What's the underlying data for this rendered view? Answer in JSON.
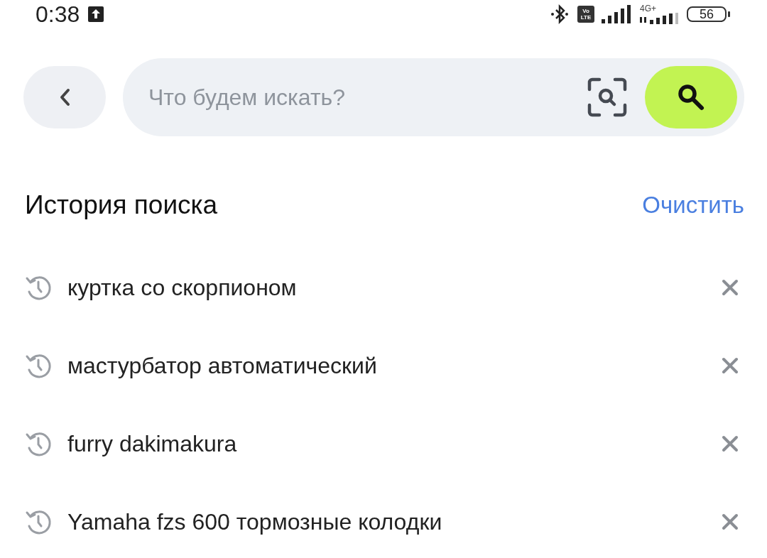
{
  "status_bar": {
    "time": "0:38",
    "volte": [
      "Vo",
      "LTE"
    ],
    "network": "4G+",
    "battery": "56"
  },
  "search": {
    "placeholder": "Что будем искать?"
  },
  "history": {
    "title": "История поиска",
    "clear": "Очистить",
    "items": [
      {
        "text": "куртка со скорпионом"
      },
      {
        "text": "мастурбатор автоматический"
      },
      {
        "text": "furry dakimakura"
      },
      {
        "text": "Yamaha fzs 600 тормозные колодки"
      }
    ]
  }
}
